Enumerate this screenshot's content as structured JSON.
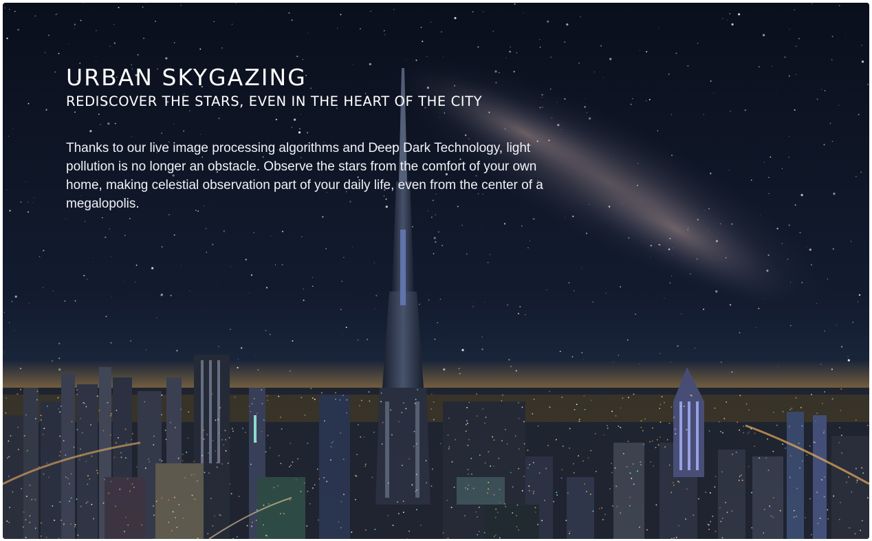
{
  "hero": {
    "title": "URBAN SKYGAZING",
    "subtitle": "REDISCOVER THE STARS, EVEN IN THE HEART OF THE CITY",
    "body": "Thanks to our live image processing algorithms and Deep Dark Technology, light pollution is no longer an obstacle. Observe the stars from the comfort of your own home, making celestial observation part of your daily life, even from the center of a megalopolis."
  },
  "colors": {
    "sky_top": "#0b111f",
    "sky_mid": "#16213a",
    "milky_way": "#8a7f86",
    "city_glow": "#d89a3e",
    "text": "#ffffff"
  }
}
